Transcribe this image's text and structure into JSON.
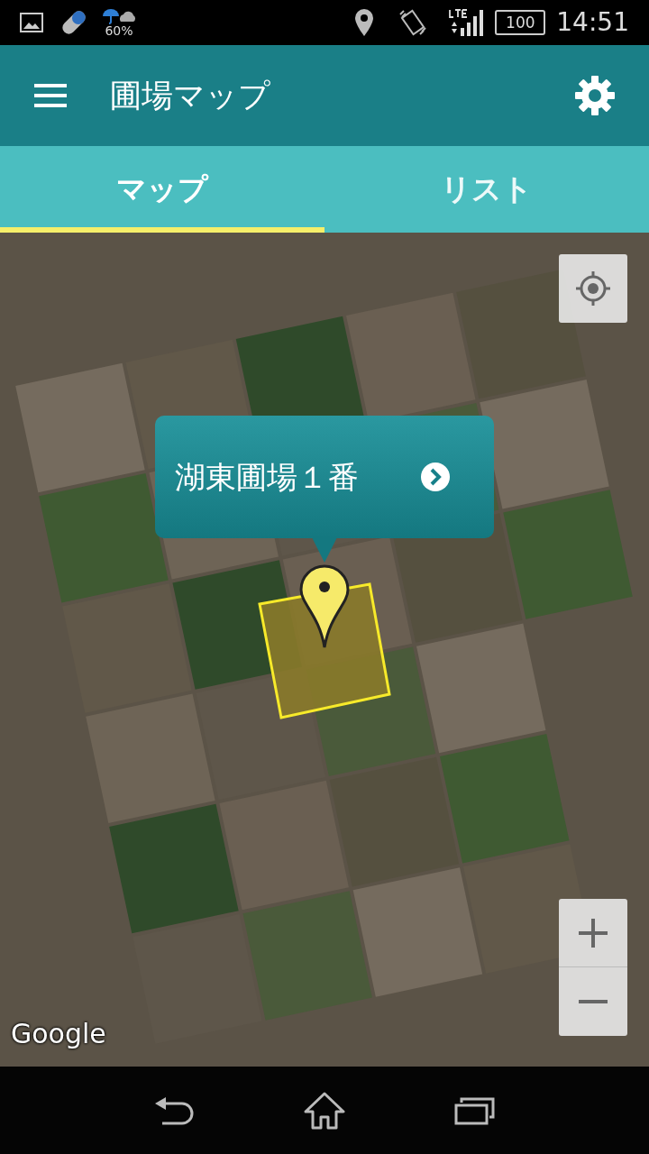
{
  "status_bar": {
    "weather_chance": "60%",
    "battery": "100",
    "time": "14:51"
  },
  "app_bar": {
    "title": "圃場マップ"
  },
  "tabs": [
    {
      "label": "マップ",
      "selected": true
    },
    {
      "label": "リスト",
      "selected": false
    }
  ],
  "map": {
    "popup": {
      "title": "湖東圃場１番"
    },
    "attribution": "Google"
  }
}
